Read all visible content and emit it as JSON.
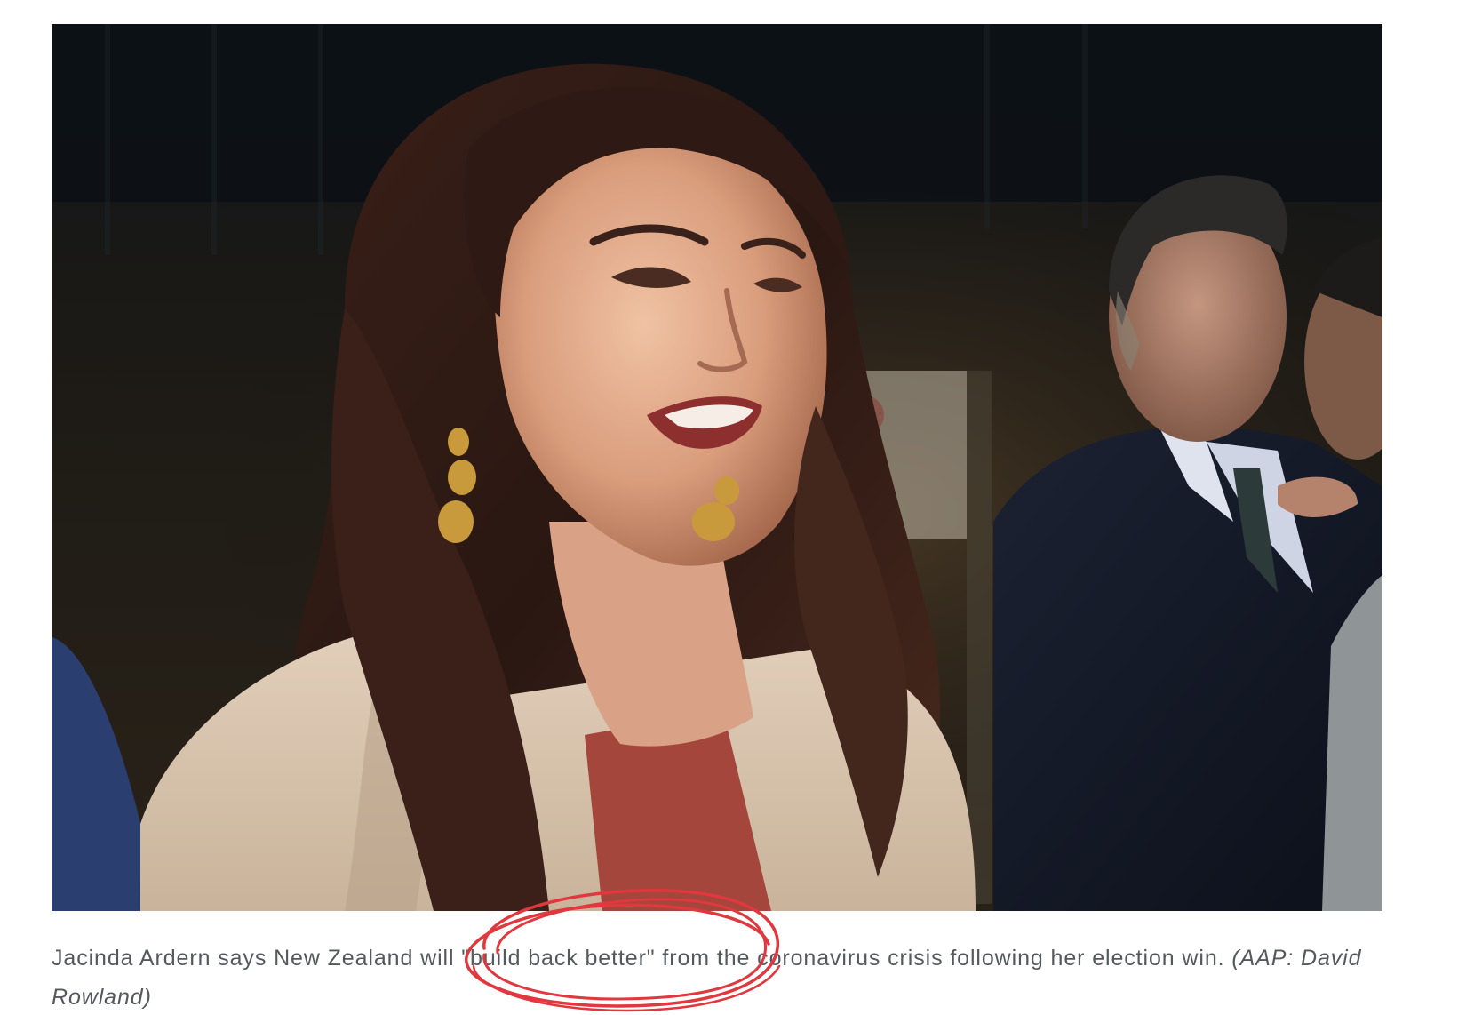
{
  "photo": {
    "subject_icon": "press-photo-woman-smiling",
    "background_icon": "press-photo-man-in-suit"
  },
  "caption": {
    "text": "Jacinda Ardern says New Zealand will \"build back better\" from the coronavirus crisis following her election win.",
    "credit": "(AAP: David Rowland)"
  },
  "annotation": {
    "icon": "hand-drawn-circle-icon",
    "color": "#e0383e"
  },
  "colors": {
    "caption_text": "#55595e",
    "background": "#ffffff"
  }
}
